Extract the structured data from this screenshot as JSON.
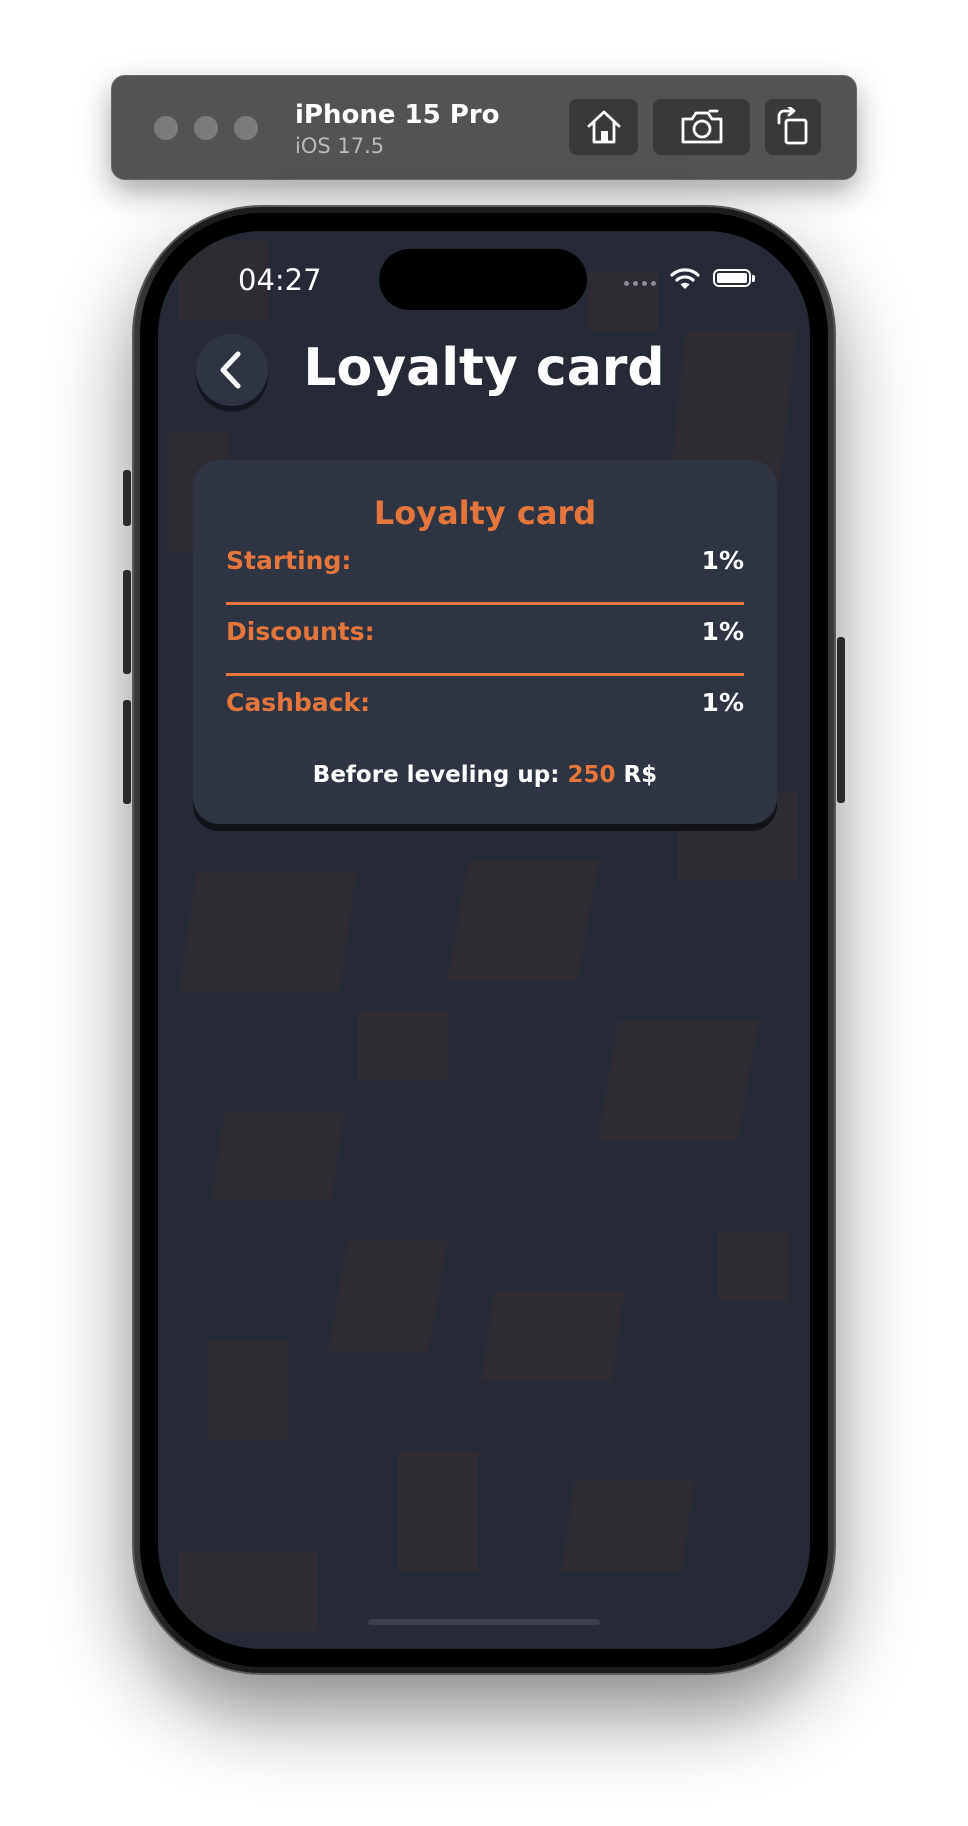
{
  "simulator": {
    "device_name": "iPhone 15 Pro",
    "os_version": "iOS 17.5",
    "home_icon": "home-icon",
    "screenshot_icon": "camera-icon",
    "rotate_icon": "rotate-icon"
  },
  "status_bar": {
    "time": "04:27",
    "wifi_icon": "wifi-icon",
    "battery_icon": "battery-icon"
  },
  "header": {
    "back_icon": "chevron-left-icon",
    "title": "Loyalty card"
  },
  "card": {
    "title": "Loyalty card",
    "rows": [
      {
        "label": "Starting:",
        "value": "1%"
      },
      {
        "label": "Discounts:",
        "value": "1%"
      },
      {
        "label": "Cashback:",
        "value": "1%"
      }
    ],
    "level_prefix": "Before leveling up:",
    "level_amount": "250",
    "level_currency": "R$"
  },
  "colors": {
    "accent": "#e3753d",
    "card_bg": "#2e3442",
    "screen_bg": "#262a36"
  }
}
